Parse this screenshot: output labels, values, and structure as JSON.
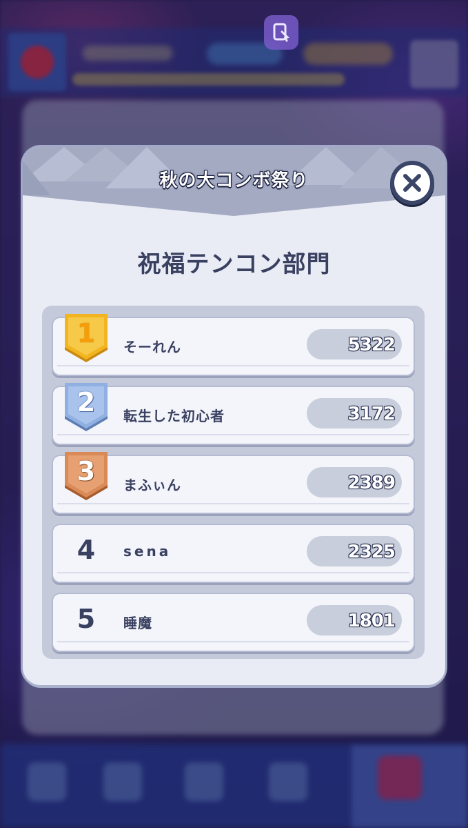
{
  "modal": {
    "title": "秋の大コンボ祭り",
    "section_title": "祝福テンコン部門"
  },
  "ranking": [
    {
      "rank": "1",
      "name": "そーれん",
      "score": "5322",
      "badge": "gold"
    },
    {
      "rank": "2",
      "name": "転生した初心者",
      "score": "3172",
      "badge": "silver"
    },
    {
      "rank": "3",
      "name": "まふぃん",
      "score": "2389",
      "badge": "bronze"
    },
    {
      "rank": "4",
      "name": "sena",
      "score": "2325",
      "badge": "none"
    },
    {
      "rank": "5",
      "name": "睡魔",
      "score": "1801",
      "badge": "none"
    }
  ],
  "colors": {
    "gold": "#f2b51f",
    "silver": "#8fb0e0",
    "bronze": "#d98a56",
    "text_dark": "#3a4060",
    "panel": "#e9ecf5"
  },
  "icons": {
    "close": "close-icon",
    "pin": "pin-icon"
  }
}
